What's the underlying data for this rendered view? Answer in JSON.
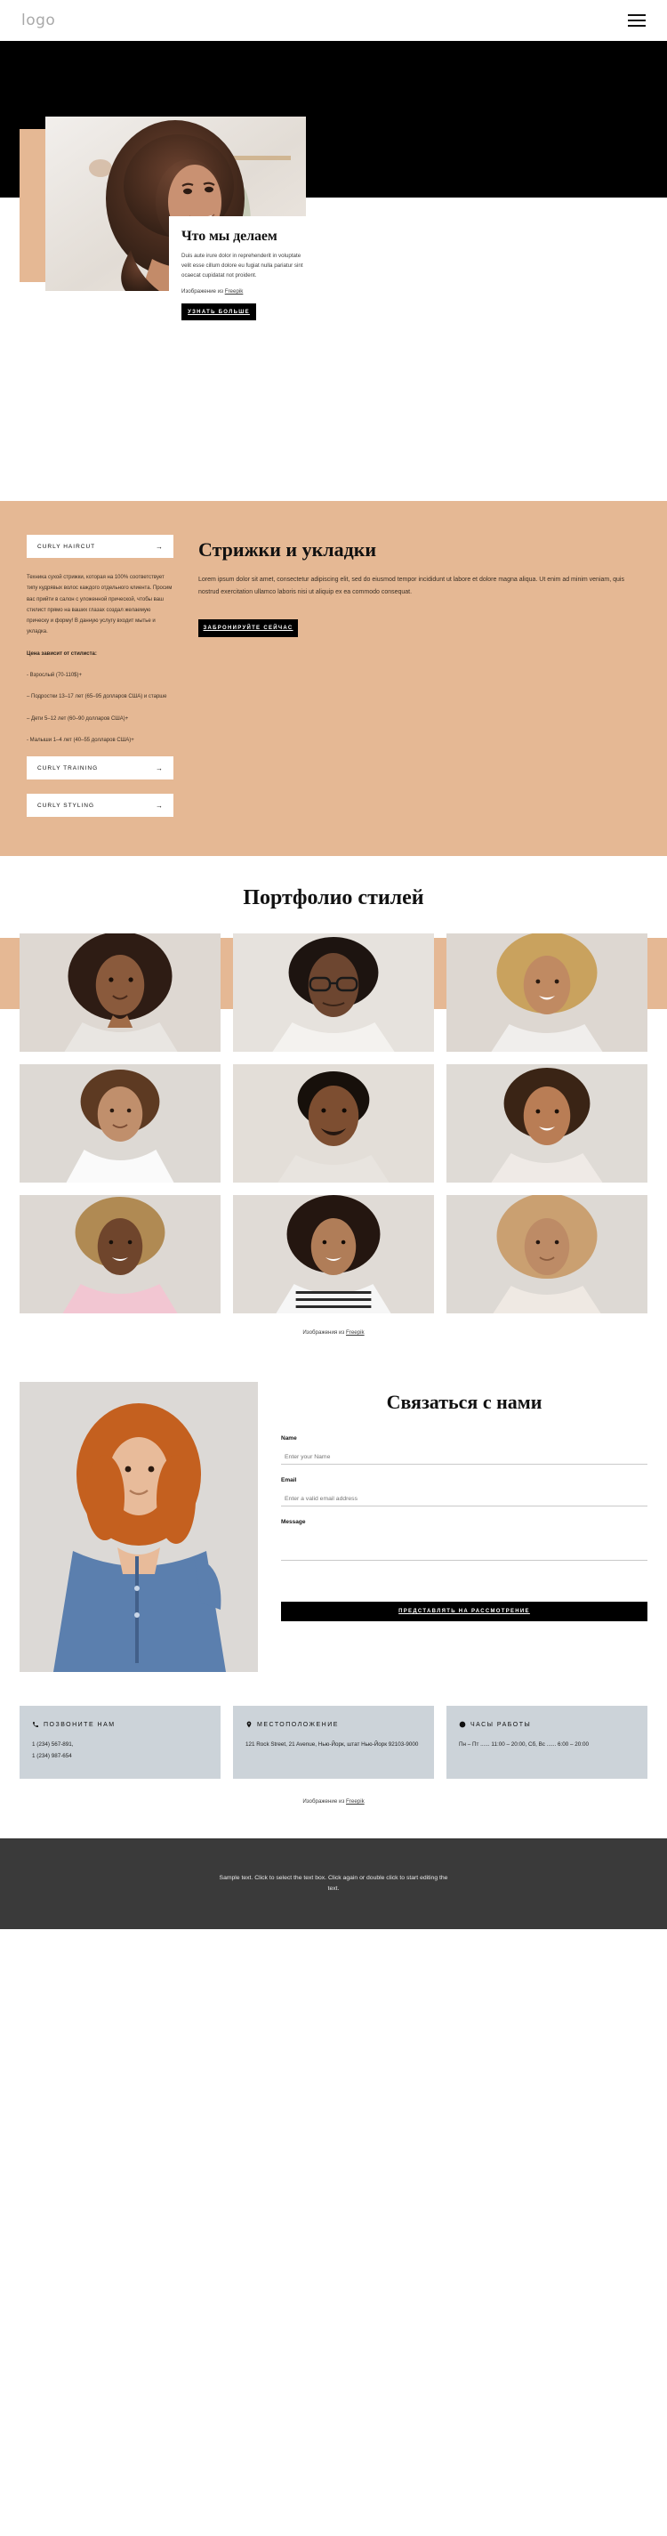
{
  "header": {
    "logo": "logo",
    "menu_icon": "hamburger-icon"
  },
  "hero": {
    "title": "Что мы делаем",
    "paragraph": "Duis aute irure dolor in reprehenderit in voluptate velit esse cillum dolore eu fugiat nulla pariatur sint ocaecat cupidatat not proident.",
    "credit_prefix": "Изображение из ",
    "credit_link": "Freepik",
    "cta": "УЗНАТЬ БОЛЬШЕ"
  },
  "services": {
    "accordion": [
      {
        "label": "CURLY HAIRCUT",
        "arrow": "→",
        "open": true
      },
      {
        "label": "CURLY TRAINING",
        "arrow": "→",
        "open": false
      },
      {
        "label": "CURLY STYLING",
        "arrow": "→",
        "open": false
      }
    ],
    "body_p1": "Техника сухой стрижки, которая на 100% соответствует типу кудрявых волос каждого отдельного клиента. Просим вас прийти в салон с уложенной прической, чтобы ваш стилист прямо на ваших глазах создал желаемую прическу и форму! В данную услугу входит мытье и укладка.",
    "price_heading": "Цена зависит от стилиста:",
    "prices": [
      "- Взрослый (70-110$)+",
      "– Подростки 13–17 лет (65–95 долларов США) и старше",
      "– Дети 5–12 лет (60–90 долларов США)+",
      "- Малыши 1–4 лет (40–55 долларов США)+"
    ],
    "heading": "Стрижки и укладки",
    "text": "Lorem ipsum dolor sit amet, consectetur adipiscing elit, sed do eiusmod tempor incididunt ut labore et dolore magna aliqua. Ut enim ad minim veniam, quis nostrud exercitation ullamco laboris nisi ut aliquip ex ea commodo consequat.",
    "cta": "ЗАБРОНИРУЙТЕ СЕЙЧАС"
  },
  "portfolio": {
    "title": "Портфолио стилей",
    "credit_prefix": "Изображения из ",
    "credit_link": "Freepik",
    "items": [
      {
        "alt": "portrait-1"
      },
      {
        "alt": "portrait-2"
      },
      {
        "alt": "portrait-3"
      },
      {
        "alt": "portrait-4"
      },
      {
        "alt": "portrait-5"
      },
      {
        "alt": "portrait-6"
      },
      {
        "alt": "portrait-7"
      },
      {
        "alt": "portrait-8"
      },
      {
        "alt": "portrait-9"
      }
    ]
  },
  "contact": {
    "title": "Связаться с нами",
    "fields": [
      {
        "label": "Name",
        "placeholder": "Enter your Name",
        "value": ""
      },
      {
        "label": "Email",
        "placeholder": "Enter a valid email address",
        "value": ""
      },
      {
        "label": "Message",
        "placeholder": "",
        "value": ""
      }
    ],
    "submit": "ПРЕДСТАВЛЯТЬ НА РАССМОТРЕНИЕ"
  },
  "info_cards": [
    {
      "icon": "phone-icon",
      "title": "ПОЗВОНИТЕ НАМ",
      "body": "1 (234) 567-891,\n1 (234) 987-654"
    },
    {
      "icon": "map-pin-icon",
      "title": "МЕСТОПОЛОЖЕНИЕ",
      "body": "121 Rock Street, 21 Avenue, Нью-Йорк, штат Нью-Йорк 92103-9000"
    },
    {
      "icon": "clock-icon",
      "title": "ЧАСЫ РАБОТЫ",
      "body": "Пн – Пт ...... 11:00 – 20:00, Сб, Вс ...... 6:00 – 20:00"
    }
  ],
  "footer_credit": {
    "prefix": "Изображение из ",
    "link": "Freepik"
  },
  "footer": {
    "text": "Sample text. Click to select the text box. Click again or double click to start editing the text."
  },
  "colors": {
    "tan": "#e5b894",
    "dark": "#000000",
    "footer_bg": "#3a3a3a",
    "info_card_bg": "#ccd3d9"
  }
}
